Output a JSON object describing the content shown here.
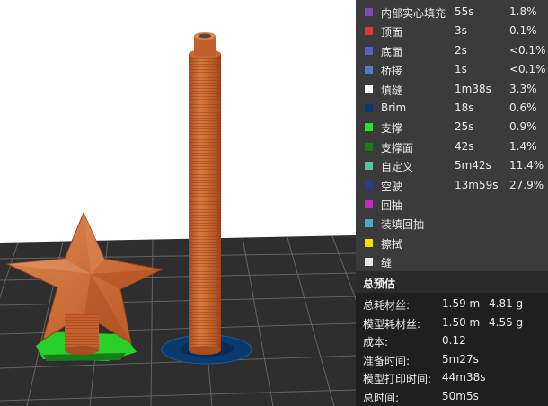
{
  "legend": [
    {
      "name": "内部实心填充",
      "time": "55s",
      "pct": "1.8%",
      "color": "#7b4fb1"
    },
    {
      "name": "顶面",
      "time": "3s",
      "pct": "0.1%",
      "color": "#d83a3a"
    },
    {
      "name": "底面",
      "time": "2s",
      "pct": "<0.1%",
      "color": "#5a5fc0"
    },
    {
      "name": "桥接",
      "time": "1s",
      "pct": "<0.1%",
      "color": "#4f7fbe"
    },
    {
      "name": "填缝",
      "time": "1m38s",
      "pct": "3.3%",
      "color": "#ffffff"
    },
    {
      "name": "Brim",
      "time": "18s",
      "pct": "0.6%",
      "color": "#0b3a6e"
    },
    {
      "name": "支撑",
      "time": "25s",
      "pct": "0.9%",
      "color": "#2ee02e"
    },
    {
      "name": "支撑面",
      "time": "42s",
      "pct": "1.4%",
      "color": "#187a18"
    },
    {
      "name": "自定义",
      "time": "5m42s",
      "pct": "11.4%",
      "color": "#55c79b"
    },
    {
      "name": "空驶",
      "time": "13m59s",
      "pct": "27.9%",
      "color": "#2d3a8a"
    },
    {
      "name": "回抽",
      "time": "",
      "pct": "",
      "color": "#c02bc0"
    },
    {
      "name": "装填回抽",
      "time": "",
      "pct": "",
      "color": "#4fa8c8"
    },
    {
      "name": "擦拭",
      "time": "",
      "pct": "",
      "color": "#f2e400"
    },
    {
      "name": "缝",
      "time": "",
      "pct": "",
      "color": "#e8e8e8"
    }
  ],
  "summary": {
    "title": "总预估",
    "rows": [
      {
        "label": "总耗材丝:",
        "value": "1.59 m",
        "value2": "4.81 g"
      },
      {
        "label": "模型耗材丝:",
        "value": "1.50 m",
        "value2": "4.55 g"
      },
      {
        "label": "成本:",
        "value": "0.12",
        "value2": ""
      },
      {
        "label": "准备时间:",
        "value": "5m27s",
        "value2": ""
      },
      {
        "label": "模型打印时间:",
        "value": "44m38s",
        "value2": ""
      },
      {
        "label": "总时间:",
        "value": "50m5s",
        "value2": ""
      }
    ]
  },
  "colors": {
    "model": "#c8602a",
    "plate": "#2e2e2e",
    "grid": "#6a6a6a",
    "panel_bg": "#3b3b3b"
  }
}
